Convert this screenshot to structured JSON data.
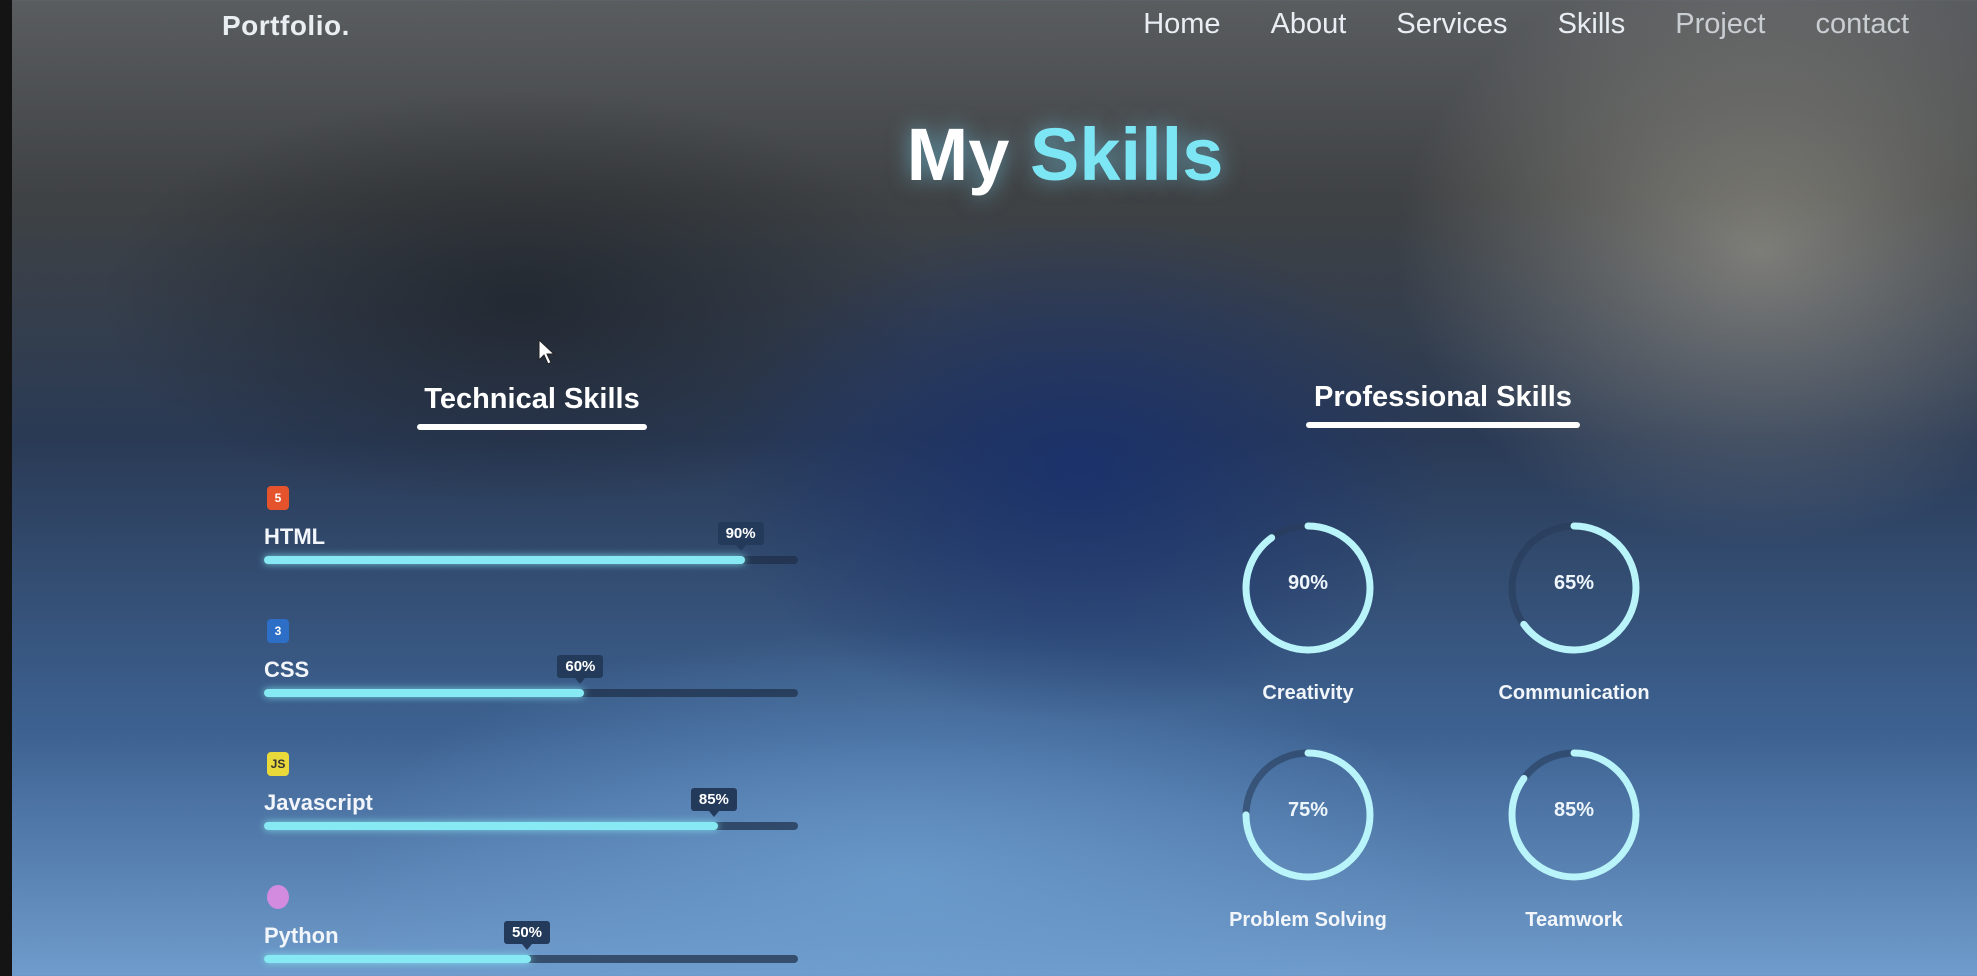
{
  "nav": {
    "logo": "Portfolio.",
    "links": [
      "Home",
      "About",
      "Services",
      "Skills",
      "Project",
      "contact"
    ]
  },
  "title": {
    "main": "My",
    "accent": "Skills"
  },
  "technical": {
    "heading": "Technical Skills",
    "items": [
      {
        "name": "HTML",
        "percent_label": "90%",
        "percent": 90,
        "icon": "html5-icon",
        "icon_glyph": "5",
        "color": "#e4532c"
      },
      {
        "name": "CSS",
        "percent_label": "60%",
        "percent": 60,
        "icon": "css3-icon",
        "icon_glyph": "3",
        "color": "#2d6fc7"
      },
      {
        "name": "Javascript",
        "percent_label": "85%",
        "percent": 85,
        "icon": "javascript-icon",
        "icon_glyph": "JS",
        "color": "#e9d93b"
      },
      {
        "name": "Python",
        "percent_label": "50%",
        "percent": 50,
        "icon": "python-icon",
        "icon_glyph": "",
        "color": "#d38be0"
      }
    ]
  },
  "professional": {
    "heading": "Professional Skills",
    "items": [
      {
        "name": "Creativity",
        "percent_label": "90%",
        "percent": 90
      },
      {
        "name": "Communication",
        "percent_label": "65%",
        "percent": 65
      },
      {
        "name": "Problem Solving",
        "percent_label": "75%",
        "percent": 75
      },
      {
        "name": "Teamwork",
        "percent_label": "85%",
        "percent": 85
      }
    ]
  },
  "colors": {
    "accent": "#7de6f5",
    "bar": "#87e9f3",
    "tag_bg": "#243a5a"
  }
}
